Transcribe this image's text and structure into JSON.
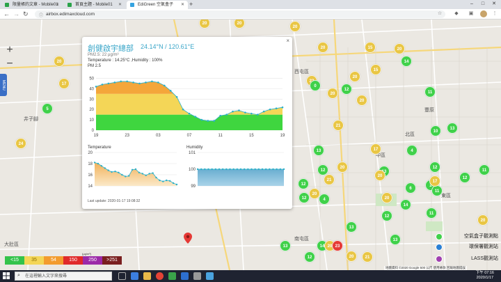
{
  "browser": {
    "tabs": [
      {
        "title": "限量帳的文章 - Mobile01",
        "active": false
      },
      {
        "title": "首頁主題 - Mobile01",
        "active": false
      },
      {
        "title": "EdiGreen 空氣盒子",
        "active": true
      }
    ],
    "url": "airbox.edimaxcloud.com"
  },
  "map": {
    "zoom_in": "+",
    "zoom_out": "−",
    "menu_label": "MENU",
    "place_labels": [
      "井子腳",
      "大肚區",
      "西屯區",
      "豐原",
      "南屯區",
      "中區",
      "北區",
      "東區"
    ],
    "markers": [
      {
        "v": "20",
        "c": "y"
      },
      {
        "v": "20",
        "c": "y"
      },
      {
        "v": "20",
        "c": "y"
      },
      {
        "v": "20",
        "c": "y"
      },
      {
        "v": "20",
        "c": "y"
      },
      {
        "v": "15",
        "c": "y"
      },
      {
        "v": "20",
        "c": "y"
      },
      {
        "v": "5",
        "c": "g"
      },
      {
        "v": "24",
        "c": "y"
      },
      {
        "v": "20",
        "c": "y"
      },
      {
        "v": "17",
        "c": "y"
      },
      {
        "v": "22",
        "c": "y"
      },
      {
        "v": "20",
        "c": "y"
      },
      {
        "v": "20",
        "c": "y"
      },
      {
        "v": "15",
        "c": "y"
      },
      {
        "v": "0",
        "c": "g"
      },
      {
        "v": "12",
        "c": "g"
      },
      {
        "v": "21",
        "c": "y"
      },
      {
        "v": "20",
        "c": "y"
      },
      {
        "v": "14",
        "c": "g"
      },
      {
        "v": "11",
        "c": "g"
      },
      {
        "v": "13",
        "c": "g"
      },
      {
        "v": "10",
        "c": "g"
      },
      {
        "v": "17",
        "c": "y"
      },
      {
        "v": "4",
        "c": "g"
      },
      {
        "v": "12",
        "c": "g"
      },
      {
        "v": "2",
        "c": "g"
      },
      {
        "v": "14",
        "c": "g"
      },
      {
        "v": "11",
        "c": "g"
      },
      {
        "v": "13",
        "c": "g"
      },
      {
        "v": "12",
        "c": "g"
      },
      {
        "v": "12",
        "c": "g"
      },
      {
        "v": "21",
        "c": "y"
      },
      {
        "v": "20",
        "c": "y"
      },
      {
        "v": "4",
        "c": "g"
      },
      {
        "v": "12",
        "c": "g"
      },
      {
        "v": "20",
        "c": "y"
      },
      {
        "v": "13",
        "c": "g"
      },
      {
        "v": "20",
        "c": "y"
      },
      {
        "v": "6",
        "c": "g"
      },
      {
        "v": "12",
        "c": "g"
      },
      {
        "v": "11",
        "c": "g"
      },
      {
        "v": "20",
        "c": "y"
      },
      {
        "v": "13",
        "c": "g"
      },
      {
        "v": "14",
        "c": "g"
      },
      {
        "v": "20",
        "c": "y"
      },
      {
        "v": "23",
        "c": "r"
      },
      {
        "v": "13",
        "c": "g"
      },
      {
        "v": "12",
        "c": "g"
      },
      {
        "v": "20",
        "c": "y"
      },
      {
        "v": "21",
        "c": "y"
      },
      {
        "v": "13",
        "c": "g"
      },
      {
        "v": "17",
        "c": "y"
      },
      {
        "v": "12",
        "c": "g"
      },
      {
        "v": "11",
        "c": "g"
      },
      {
        "v": "20",
        "c": "y"
      }
    ]
  },
  "popup": {
    "site_name": "創健啟宇總部",
    "coords": "24.14°N / 120.61°E",
    "pm_line": "PM2.5: 22 μg/m³",
    "env_line": "Temperature : 14.25°C ,Humidity : 100%",
    "pm_chart_title": "PM 2.5",
    "temp_chart_title": "Temperature",
    "hum_chart_title": "Humidity",
    "last_update": "Last update: 2020-01-17 19:08:32",
    "close": "×"
  },
  "chart_data": [
    {
      "type": "area",
      "title": "PM 2.5",
      "x_ticks": [
        "19",
        "23",
        "03",
        "07",
        "11",
        "15",
        "19"
      ],
      "y_ticks": [
        0,
        10,
        20,
        30,
        40,
        50
      ],
      "ylim": [
        0,
        55
      ],
      "values": [
        42,
        44,
        45,
        46,
        47,
        47,
        46,
        45,
        46,
        47,
        46,
        43,
        38,
        32,
        20,
        16,
        13,
        10,
        9,
        9,
        14,
        15,
        18,
        19,
        17,
        16,
        15,
        18,
        20,
        21,
        22
      ],
      "band_colors": [
        "#3fd63f",
        "#f4d657",
        "#f4a63a"
      ]
    },
    {
      "type": "area",
      "title": "Temperature",
      "y_ticks": [
        14,
        16,
        18,
        20
      ],
      "ylim": [
        14,
        20
      ],
      "values": [
        18.2,
        18.0,
        17.6,
        17.2,
        16.8,
        16.5,
        16.6,
        16.4,
        16.0,
        15.7,
        15.8,
        16.9,
        17.0,
        16.4,
        16.2,
        15.9,
        16.2,
        16.3,
        15.5,
        15.0,
        14.8,
        15.0,
        14.9,
        14.5,
        14.25
      ]
    },
    {
      "type": "area",
      "title": "Humidity",
      "y_ticks": [
        99,
        100,
        101
      ],
      "ylim": [
        99,
        101
      ],
      "values": [
        100,
        100,
        100,
        100,
        100,
        100,
        100,
        100,
        100,
        100,
        100,
        100,
        100,
        100,
        100,
        100,
        100,
        100,
        100,
        100,
        100,
        100,
        100,
        100,
        100
      ]
    }
  ],
  "legend": {
    "unit": "(μg/m³)",
    "items": [
      {
        "label": "<15",
        "color": "#34c34a"
      },
      {
        "label": "35",
        "color": "#f4d657"
      },
      {
        "label": "54",
        "color": "#f39c2e"
      },
      {
        "label": "150",
        "color": "#e02a2a"
      },
      {
        "label": "250",
        "color": "#9c2aa8"
      },
      {
        "label": ">251",
        "color": "#7a1f1f"
      }
    ]
  },
  "layers": {
    "airbox": "空氣盒子觀測點",
    "epa": "環保署觀測站",
    "lass": "LASS觀測站"
  },
  "map_footer": "地圖資料 ©2020 Google    500 公尺    使用條款    回報地圖錯誤",
  "taskbar": {
    "search_placeholder": "在這裡輸入文字來搜尋",
    "time": "下午 07:16",
    "date": "2020/1/17"
  }
}
